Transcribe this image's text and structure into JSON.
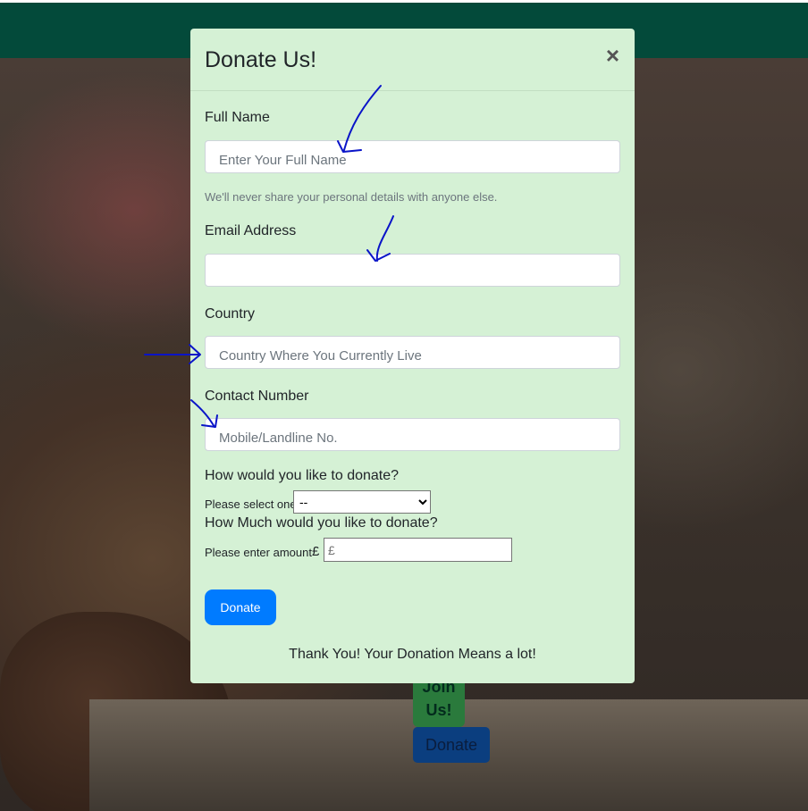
{
  "modal": {
    "title": "Donate Us!",
    "close_glyph": "×",
    "fields": {
      "full_name": {
        "label": "Full Name",
        "placeholder": "Enter Your Full Name"
      },
      "help_text": "We'll never share your personal details with anyone else.",
      "email": {
        "label": "Email Address",
        "placeholder": ""
      },
      "country": {
        "label": "Country",
        "placeholder": "Country Where You Currently Live"
      },
      "contact": {
        "label": "Contact Number",
        "placeholder": "Mobile/Landline No."
      }
    },
    "donation_method": {
      "question": "How would you like to donate?",
      "select_label": "Please select one",
      "selected_option": "--"
    },
    "donation_amount": {
      "question": "How Much would you like to donate?",
      "amount_label": "Please enter amount",
      "currency_symbol": "£",
      "placeholder": "£"
    },
    "submit_label": "Donate",
    "thank_you": "Thank You! Your Donation Means a lot!"
  },
  "hero": {
    "join_label": "Join Us!",
    "donate_label": "Donate"
  },
  "colors": {
    "navbar": "#034a3a",
    "modal_bg": "#d5f1d5",
    "primary_button": "#007bff",
    "annotation_ink": "#0a14c8"
  },
  "annotations": [
    "arrow-icon",
    "arrow-icon",
    "arrow-icon",
    "arrow-icon"
  ]
}
